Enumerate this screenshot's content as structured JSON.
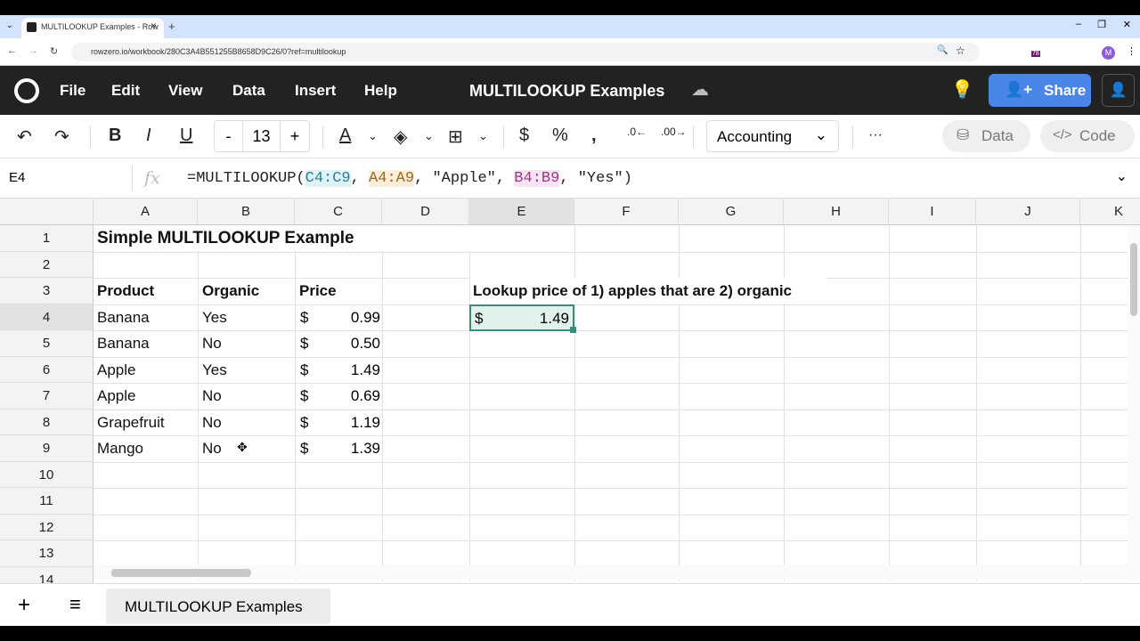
{
  "browser": {
    "tab_title": "MULTILOOKUP Examples - Row",
    "url": "rowzero.io/workbook/280C3A4B551255B8658D9C26/0?ref=multilookup",
    "ext_badge": "78",
    "profile": "M"
  },
  "app": {
    "menus": [
      "File",
      "Edit",
      "View",
      "Data",
      "Insert",
      "Help"
    ],
    "title": "MULTILOOKUP Examples",
    "share": "Share",
    "accent": "#4a86e8"
  },
  "toolbar": {
    "font_size": "13",
    "minus": "-",
    "plus": "+",
    "format": "Accounting",
    "data_btn": "Data",
    "code_btn": "Code",
    "more": "···"
  },
  "formula": {
    "cell_ref": "E4",
    "fx": "fx",
    "prefix": "=MULTILOOKUP(",
    "r1": "C4:C9",
    "r2": "A4:A9",
    "s1": "\"Apple\"",
    "r3": "B4:B9",
    "s2": "\"Yes\")",
    "sep": ", "
  },
  "columns": [
    "A",
    "B",
    "C",
    "D",
    "E",
    "F",
    "G",
    "H",
    "I",
    "J",
    "K"
  ],
  "rows": [
    "1",
    "2",
    "3",
    "4",
    "5",
    "6",
    "7",
    "8",
    "9",
    "10",
    "11",
    "12",
    "13",
    "14"
  ],
  "title_cell": "Simple MULTILOOKUP Example",
  "headers": {
    "product": "Product",
    "organic": "Organic",
    "price": "Price"
  },
  "table": [
    {
      "product": "Banana",
      "organic": "Yes",
      "price": "0.99"
    },
    {
      "product": "Banana",
      "organic": "No",
      "price": "0.50"
    },
    {
      "product": "Apple",
      "organic": "Yes",
      "price": "1.49"
    },
    {
      "product": "Apple",
      "organic": "No",
      "price": "0.69"
    },
    {
      "product": "Grapefruit",
      "organic": "No",
      "price": "1.19"
    },
    {
      "product": "Mango",
      "organic": "No",
      "price": "1.39"
    }
  ],
  "currency": "$",
  "lookup_label": "Lookup price of 1) apples that are 2) organic",
  "result": "1.49",
  "sheet_tab": "MULTILOOKUP Examples"
}
